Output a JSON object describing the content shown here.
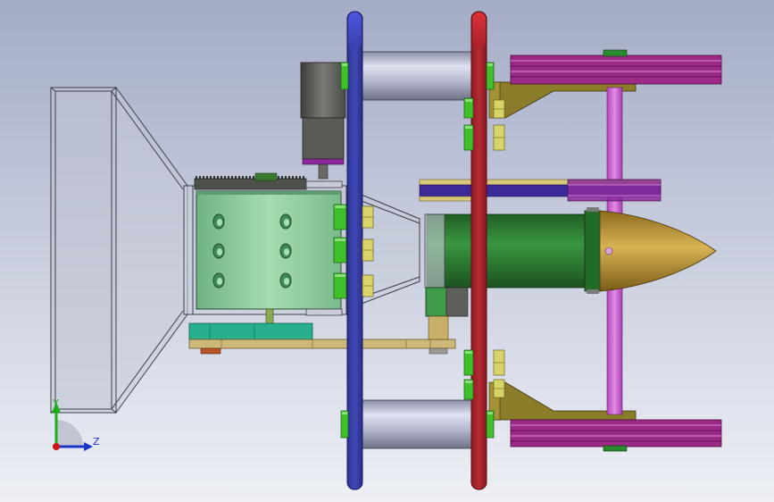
{
  "viewport": {
    "background_top": "#a4acc6",
    "background_bottom": "#eef0f6"
  },
  "triad": {
    "y_label": "Y",
    "z_label": "Z",
    "y_color": "#19b019",
    "z_color": "#1a35c8",
    "origin_color": "#d01515"
  },
  "colors": {
    "front_plate": "#3a3fa8",
    "rear_plate": "#a82028",
    "cylinder_steel": "#a8acc4",
    "nut_yellow": "#d8d46a",
    "bolt_green": "#3fbf2a",
    "motor_gray": "#5a5c58",
    "drum_green": "#8ec89a",
    "shaft_green": "#2c7a30",
    "nose_cone": "#c09a3c",
    "wheel_magenta": "#a02a88",
    "axle_violet": "#d266d8",
    "bracket_olive": "#8a7c28",
    "belt_indigo": "#3c2a98",
    "base_tan": "#c8b47a",
    "plate_teal": "#2ab090"
  }
}
